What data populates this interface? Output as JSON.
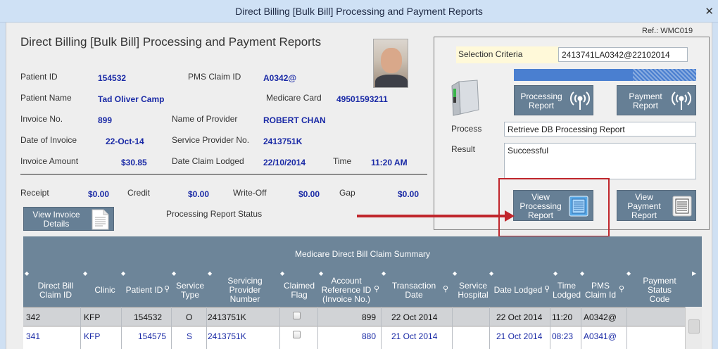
{
  "window": {
    "title": "Direct Billing [Bulk Bill] Processing and Payment Reports",
    "close_glyph": "✕"
  },
  "ref_label": "Ref.: WMC019",
  "page_title": "Direct Billing [Bulk Bill] Processing and Payment Reports",
  "details": {
    "patient_id": {
      "label": "Patient ID",
      "value": "154532"
    },
    "pms_claim_id": {
      "label": "PMS Claim ID",
      "value": "A0342@"
    },
    "patient_name": {
      "label": "Patient Name",
      "value": "Tad Oliver Camp"
    },
    "medicare_card": {
      "label": "Medicare Card",
      "value": "49501593211"
    },
    "invoice_no": {
      "label": "Invoice No.",
      "value": "899"
    },
    "provider_name": {
      "label": "Name of Provider",
      "value": "ROBERT CHAN"
    },
    "invoice_date": {
      "label": "Date of Invoice",
      "value": "22-Oct-14"
    },
    "service_provider_no": {
      "label": "Service Provider No.",
      "value": "2413751K"
    },
    "invoice_amount": {
      "label": "Invoice Amount",
      "value": "$30.85"
    },
    "date_claim_lodged": {
      "label": "Date Claim Lodged",
      "value": "22/10/2014"
    },
    "time": {
      "label": "Time",
      "value": "11:20 AM"
    }
  },
  "totals": {
    "receipt": {
      "label": "Receipt",
      "value": "$0.00"
    },
    "credit": {
      "label": "Credit",
      "value": "$0.00"
    },
    "write_off": {
      "label": "Write-Off",
      "value": "$0.00"
    },
    "gap": {
      "label": "Gap",
      "value": "$0.00"
    }
  },
  "buttons": {
    "view_invoice": [
      "View Invoice",
      "Details"
    ],
    "processing_report": [
      "Processing",
      "Report"
    ],
    "payment_report": [
      "Payment",
      "Report"
    ],
    "view_processing": [
      "View",
      "Processing",
      "Report"
    ],
    "view_payment": [
      "View",
      "Payment",
      "Report"
    ]
  },
  "processing_status_label": "Processing Report Status",
  "criteria": {
    "label": "Selection Criteria",
    "value": "2413741LA0342@22102014",
    "process_label": "Process",
    "process_value": "Retrieve DB Processing Report",
    "result_label": "Result",
    "result_value": "Successful"
  },
  "grid": {
    "caption": "Medicare Direct Bill Claim Summary",
    "columns": [
      [
        "Direct Bill",
        "Claim ID"
      ],
      [
        "Clinic"
      ],
      [
        "Patient ID"
      ],
      [
        "Service",
        "Type"
      ],
      [
        "Servicing",
        "Provider",
        "Number"
      ],
      [
        "Claimed",
        "Flag"
      ],
      [
        "Account",
        "Reference ID",
        "(Invoice No.)"
      ],
      [
        "Transaction",
        "Date"
      ],
      [
        "Service",
        "Hospital"
      ],
      [
        "Date Lodged"
      ],
      [
        "Time",
        "Lodged"
      ],
      [
        "PMS",
        "Claim Id"
      ],
      [
        "Payment",
        "Status",
        "Code"
      ]
    ],
    "rows": [
      {
        "claim_id": "342",
        "clinic": "KFP",
        "patient_id": "154532",
        "service_type": "O",
        "provider": "2413751K",
        "account_ref": "899",
        "transaction_date": "22 Oct 2014",
        "date_lodged": "22 Oct 2014",
        "time_lodged": "11:20",
        "pms_claim_id": "A0342@"
      },
      {
        "claim_id": "341",
        "clinic": "KFP",
        "patient_id": "154575",
        "service_type": "S",
        "provider": "2413751K",
        "account_ref": "880",
        "transaction_date": "21 Oct 2014",
        "date_lodged": "21 Oct 2014",
        "time_lodged": "08:23",
        "pms_claim_id": "A0341@"
      }
    ]
  },
  "colors": {
    "accent_blue": "#1a2aa6",
    "button_slate": "#667f95",
    "highlight_red": "#c0262c",
    "grid_header": "#6d8599"
  }
}
